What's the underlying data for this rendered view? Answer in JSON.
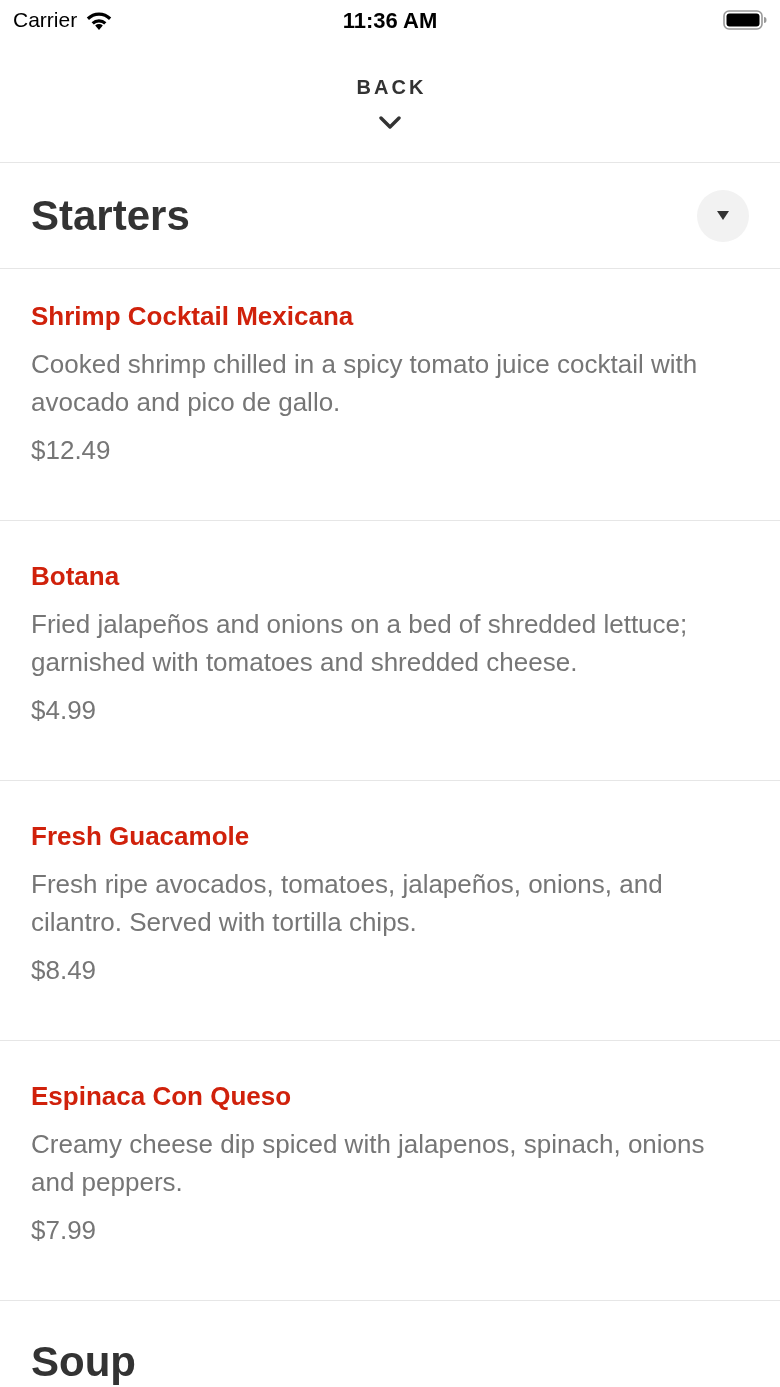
{
  "status_bar": {
    "carrier": "Carrier",
    "time": "11:36 AM"
  },
  "header": {
    "back_label": "BACK"
  },
  "sections": [
    {
      "title": "Starters",
      "toggle": true,
      "items": [
        {
          "name": "Shrimp Cocktail Mexicana",
          "description": "Cooked shrimp chilled in a spicy tomato juice cocktail with avocado and pico de gallo.",
          "price": "$12.49"
        },
        {
          "name": "Botana",
          "description": "Fried jalapeños and onions on a bed of shredded lettuce; garnished with tomatoes and shredded cheese.",
          "price": "$4.99"
        },
        {
          "name": "Fresh Guacamole",
          "description": "Fresh ripe avocados, tomatoes, jalapeños, onions, and cilantro. Served with tortilla chips.",
          "price": "$8.49"
        },
        {
          "name": "Espinaca Con Queso",
          "description": "Creamy cheese dip spiced with jalapenos, spinach, onions and peppers.",
          "price": "$7.99"
        }
      ]
    },
    {
      "title": "Soup",
      "toggle": false
    }
  ]
}
